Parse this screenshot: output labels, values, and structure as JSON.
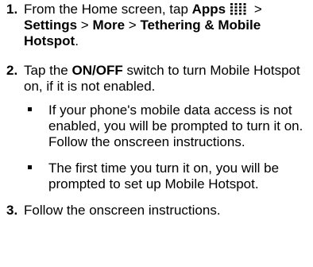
{
  "steps": [
    {
      "number": "1.",
      "parts": {
        "p1": "From the Home screen, tap ",
        "apps": "Apps",
        "p2": " > ",
        "settings": "Settings",
        "p3": " > ",
        "more": "More",
        "p4": " > ",
        "tethering": "Tethering & Mobile Hotspot",
        "p5": "."
      },
      "icon": "apps-grid-icon"
    },
    {
      "number": "2.",
      "parts": {
        "p1": "Tap the ",
        "switch": "ON/OFF",
        "p2": " switch to turn Mobile Hotspot on, if it is not enabled."
      },
      "bullets": [
        "If your phone's mobile data access is not enabled, you will be prompted to turn it on. Follow the onscreen instructions.",
        "The first time you turn it on, you will be prompted to set up Mobile Hotspot."
      ]
    },
    {
      "number": "3.",
      "text": "Follow the onscreen instructions."
    }
  ],
  "colors": {
    "text": "#000000",
    "background": "#ffffff"
  }
}
